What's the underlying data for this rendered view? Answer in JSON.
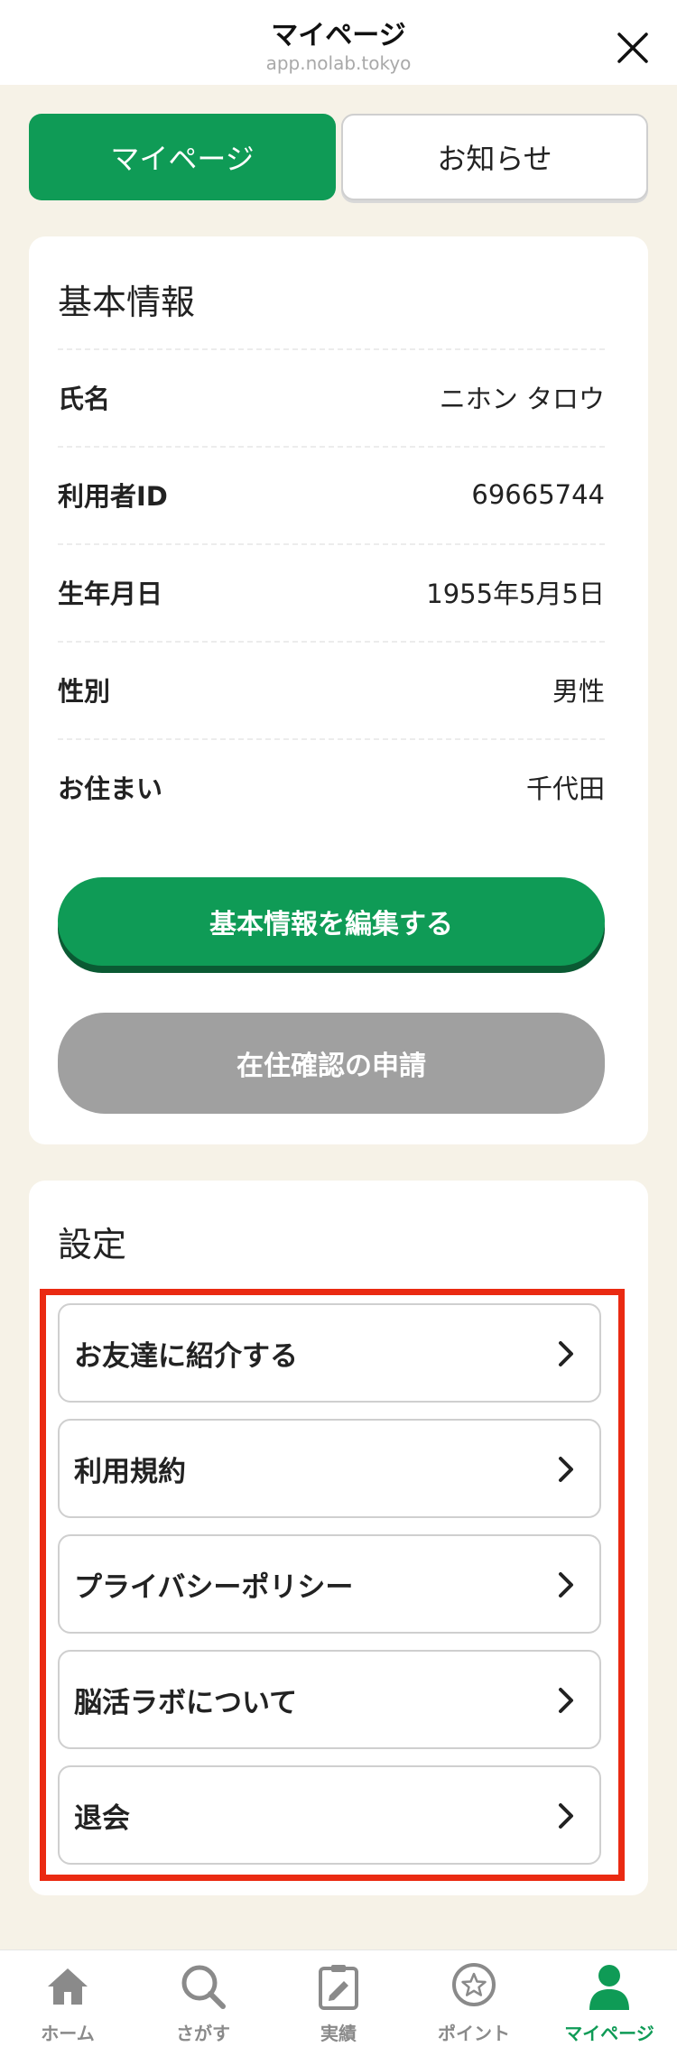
{
  "header": {
    "title": "マイページ",
    "url": "app.nolab.tokyo"
  },
  "tabs": [
    {
      "label": "マイページ",
      "active": true
    },
    {
      "label": "お知らせ",
      "active": false
    }
  ],
  "basic_info": {
    "title": "基本情報",
    "rows": [
      {
        "label": "氏名",
        "value": "ニホン タロウ"
      },
      {
        "label": "利用者ID",
        "value": "69665744"
      },
      {
        "label": "生年月日",
        "value": "1955年5月5日"
      },
      {
        "label": "性別",
        "value": "男性"
      },
      {
        "label": "お住まい",
        "value": "千代田"
      }
    ],
    "edit_button": "基本情報を編集する",
    "residence_button": "在住確認の申請"
  },
  "settings": {
    "title": "設定",
    "items": [
      {
        "label": "お友達に紹介する"
      },
      {
        "label": "利用規約"
      },
      {
        "label": "プライバシーポリシー"
      },
      {
        "label": "脳活ラボについて"
      },
      {
        "label": "退会"
      }
    ]
  },
  "bottom_nav": [
    {
      "label": "ホーム",
      "icon": "home-icon"
    },
    {
      "label": "さがす",
      "icon": "search-icon"
    },
    {
      "label": "実績",
      "icon": "clipboard-icon"
    },
    {
      "label": "ポイント",
      "icon": "star-badge-icon"
    },
    {
      "label": "マイページ",
      "icon": "person-icon",
      "active": true
    }
  ],
  "colors": {
    "accent": "#0f9b56",
    "accent_shadow": "#0a5a33",
    "disabled": "#a0a0a0",
    "highlight": "#ea2a12",
    "background": "#f6f2e7"
  }
}
